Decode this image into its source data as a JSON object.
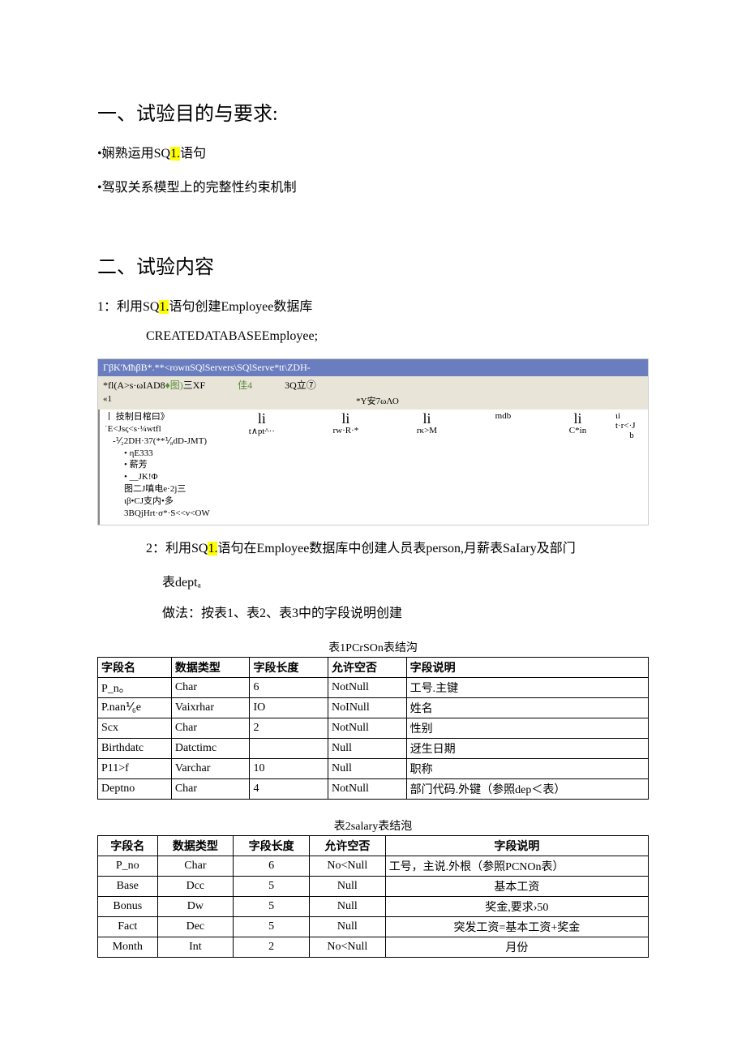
{
  "section1": {
    "title": "一、试验目的与要求:",
    "bullet1_prefix": "•娴熟运用SQ",
    "bullet1_hl": "1.",
    "bullet1_suffix": "语句",
    "bullet2": "•驾驭关系模型上的完整性约束机制"
  },
  "section2": {
    "title": "二、试验内容",
    "item1_prefix": "1：利用SQ",
    "item1_hl": "1.",
    "item1_suffix": "语句创建Employee数据库",
    "item1_code": "CREATEDATABASEEmployee;",
    "item2_prefix": "2：利用SQ",
    "item2_hl": "1.",
    "item2_suffix": "语句在Employee数据库中创建人员表person,月薪表SaIary及部门",
    "item2_line2": "表deptₐ",
    "item2_method": "做法：按表1、表2、表3中的字段说明创建"
  },
  "codewin": {
    "titlebar": "ΓβK'MħβB*.**<rownSQlServers\\SQlServe*tt\\ZDH-",
    "tool1": "*fl(A>s·ωIAD8",
    "tool1b": "♦图)",
    "tool1c": "三XF",
    "tool2": "佳4",
    "tool3": "3Q立⑦",
    "sub_left": "«1",
    "sub_mid": "*Y安7ωΛΟ",
    "left_line1": "丨 技制日棺曰》",
    "left_line2": "ˈE<Jsς<s·¼wtfl",
    "left_line3": "-⅟₂2DH·37(**⅟₈dD-JMT)",
    "left_b1": "• ηE333",
    "left_b2": "• 薪芳",
    "left_b3": "• __JK!Φ",
    "left_line4": "图二J嗔电e·2j三",
    "left_line5": "ιβ•CJ支内•多",
    "left_line6": "3BQjHrt·σ*·S<<v<OW",
    "icons": [
      {
        "glyph": "li",
        "label": "t∧pt^··"
      },
      {
        "glyph": "li",
        "label": "rw·R·*"
      },
      {
        "glyph": "li",
        "label": "rκ>M"
      },
      {
        "glyph": "",
        "label": "mdb"
      },
      {
        "glyph": "li",
        "label": "C*in"
      }
    ],
    "rightnote_line1": "ιi",
    "rightnote_line2": "t·r<·J",
    "rightnote_line3": "b"
  },
  "table1": {
    "caption": "表1PCrSOn表结沟",
    "headers": [
      "字段名",
      "数据类型",
      "字段长度",
      "允许空否",
      "字段说明"
    ],
    "rows": [
      [
        "P_n。",
        "Char",
        "6",
        "NotNull",
        "工号.主键"
      ],
      [
        "P.nan⅟₆e",
        "Vaixrhar",
        "IO",
        "NoINull",
        "姓名"
      ],
      [
        "Scx",
        "Char",
        "2",
        "NotNull",
        "性别"
      ],
      [
        "Birthdatc",
        "Datctimc",
        "",
        "Null",
        "迓生日期"
      ],
      [
        "P11>f",
        "Varchar",
        "10",
        "Null",
        "职称"
      ],
      [
        "Deptno",
        "Char",
        "4",
        "NotNull",
        "部门代码.外键（参照dep＜表）"
      ]
    ]
  },
  "table2": {
    "caption": "表2salary表结泡",
    "headers": [
      "字段名",
      "数据类型",
      "字段长度",
      "允许空否",
      "字段说明"
    ],
    "rows": [
      [
        "P_no",
        "Char",
        "6",
        "No<Null",
        "工号，主说.外根（参照PCNOn表）"
      ],
      [
        "Base",
        "Dcc",
        "5",
        "Null",
        "基本工资"
      ],
      [
        "Bonus",
        "Dw",
        "5",
        "Null",
        "奖金,要求›50"
      ],
      [
        "Fact",
        "Dec",
        "5",
        "Null",
        "突发工资=基本工资+奖金"
      ],
      [
        "Month",
        "Int",
        "2",
        "No<Null",
        "月份"
      ]
    ]
  }
}
